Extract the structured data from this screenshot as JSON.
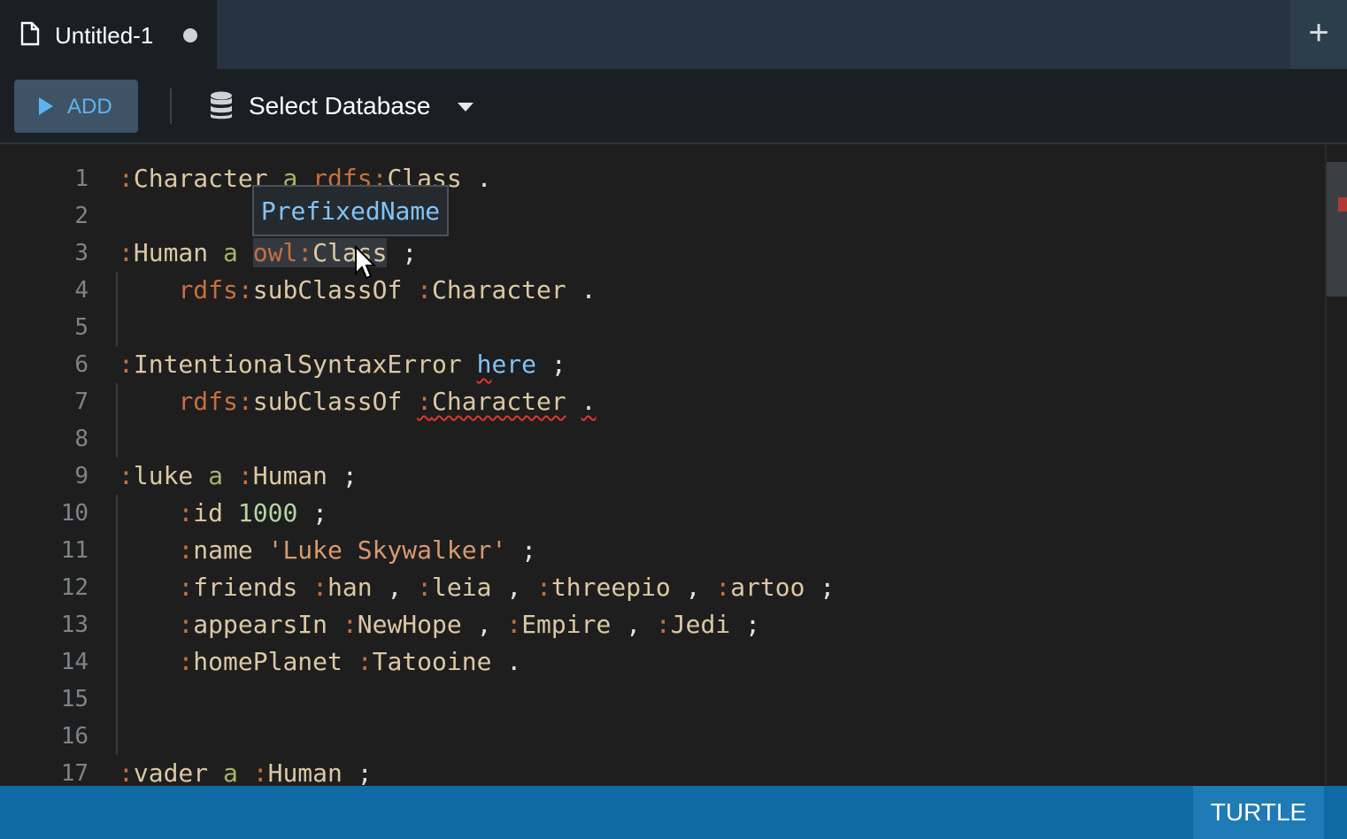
{
  "tab": {
    "title": "Untitled-1",
    "new_tab_label": "+"
  },
  "toolbar": {
    "add_label": "ADD",
    "database_label": "Select Database"
  },
  "editor": {
    "line_numbers": [
      "1",
      "2",
      "3",
      "4",
      "5",
      "6",
      "7",
      "8",
      "9",
      "10",
      "11",
      "12",
      "13",
      "14",
      "15",
      "16",
      "17"
    ],
    "tooltip": "PrefixedName",
    "lines": [
      ":Character a rdfs:Class .",
      "",
      ":Human a owl:Class ;",
      "    rdfs:subClassOf :Character .",
      "",
      ":IntentionalSyntaxError here ;",
      "    rdfs:subClassOf :Character .",
      "",
      ":luke a :Human ;",
      "    :id 1000 ;",
      "    :name 'Luke Skywalker' ;",
      "    :friends :han , :leia , :threepio , :artoo ;",
      "    :appearsIn :NewHope , :Empire , :Jedi ;",
      "    :homePlanet :Tatooine .",
      "",
      "",
      ":vader a :Human ;"
    ]
  },
  "status": {
    "mode": "TURTLE"
  },
  "colors": {
    "status_bar": "#0f6aa3",
    "accent": "#5fb3f0",
    "error_underline": "#e0372b"
  }
}
